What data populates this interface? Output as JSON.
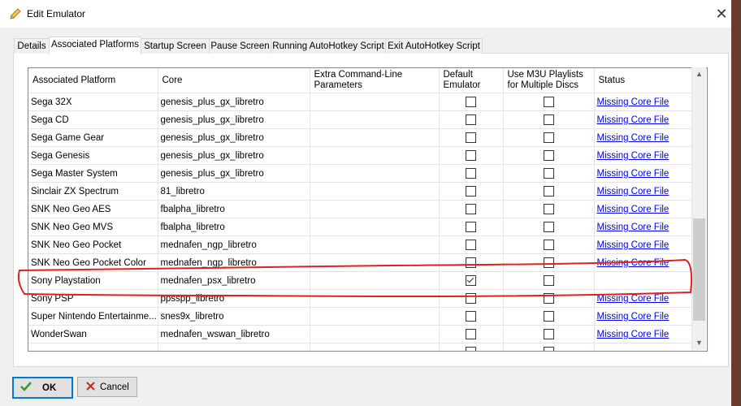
{
  "window": {
    "title": "Edit Emulator",
    "close_glyph": "✕"
  },
  "tabs": [
    {
      "label": "Details",
      "active": false
    },
    {
      "label": "Associated Platforms",
      "active": true
    },
    {
      "label": "Startup Screen",
      "active": false
    },
    {
      "label": "Pause Screen",
      "active": false
    },
    {
      "label": "Running AutoHotkey Script",
      "active": false
    },
    {
      "label": "Exit AutoHotkey Script",
      "active": false
    }
  ],
  "grid": {
    "columns": {
      "platform": "Associated Platform",
      "core": "Core",
      "extra_args": "Extra Command-Line Parameters",
      "default_emulator": "Default Emulator",
      "m3u": "Use M3U Playlists for Multiple Discs",
      "status": "Status"
    },
    "rows": [
      {
        "platform": "Sega 32X",
        "core": "genesis_plus_gx_libretro",
        "extra": "",
        "default": false,
        "m3u": false,
        "status": "Missing Core File"
      },
      {
        "platform": "Sega CD",
        "core": "genesis_plus_gx_libretro",
        "extra": "",
        "default": false,
        "m3u": false,
        "status": "Missing Core File"
      },
      {
        "platform": "Sega Game Gear",
        "core": "genesis_plus_gx_libretro",
        "extra": "",
        "default": false,
        "m3u": false,
        "status": "Missing Core File"
      },
      {
        "platform": "Sega Genesis",
        "core": "genesis_plus_gx_libretro",
        "extra": "",
        "default": false,
        "m3u": false,
        "status": "Missing Core File"
      },
      {
        "platform": "Sega Master System",
        "core": "genesis_plus_gx_libretro",
        "extra": "",
        "default": false,
        "m3u": false,
        "status": "Missing Core File"
      },
      {
        "platform": "Sinclair ZX Spectrum",
        "core": "81_libretro",
        "extra": "",
        "default": false,
        "m3u": false,
        "status": "Missing Core File"
      },
      {
        "platform": "SNK Neo Geo AES",
        "core": "fbalpha_libretro",
        "extra": "",
        "default": false,
        "m3u": false,
        "status": "Missing Core File"
      },
      {
        "platform": "SNK Neo Geo MVS",
        "core": "fbalpha_libretro",
        "extra": "",
        "default": false,
        "m3u": false,
        "status": "Missing Core File"
      },
      {
        "platform": "SNK Neo Geo Pocket",
        "core": "mednafen_ngp_libretro",
        "extra": "",
        "default": false,
        "m3u": false,
        "status": "Missing Core File"
      },
      {
        "platform": "SNK Neo Geo Pocket Color",
        "core": "mednafen_ngp_libretro",
        "extra": "",
        "default": false,
        "m3u": false,
        "status": "Missing Core File"
      },
      {
        "platform": "Sony Playstation",
        "core": "mednafen_psx_libretro",
        "extra": "",
        "default": true,
        "m3u": false,
        "status": ""
      },
      {
        "platform": "Sony PSP",
        "core": "ppsspp_libretro",
        "extra": "",
        "default": false,
        "m3u": false,
        "status": "Missing Core File"
      },
      {
        "platform": "Super Nintendo Entertainme...",
        "core": "snes9x_libretro",
        "extra": "",
        "default": false,
        "m3u": false,
        "status": "Missing Core File"
      },
      {
        "platform": "WonderSwan",
        "core": "mednafen_wswan_libretro",
        "extra": "",
        "default": false,
        "m3u": false,
        "status": "Missing Core File"
      },
      {
        "platform": "",
        "core": "",
        "extra": "",
        "default": false,
        "m3u": false,
        "status": ""
      }
    ]
  },
  "buttons": {
    "ok": "OK",
    "cancel": "Cancel"
  },
  "colors": {
    "link": "#0000ee",
    "annotation": "#e02020",
    "focus": "#0078d7",
    "ok_icon": "#2a9d2a",
    "cancel_icon": "#d42020"
  },
  "icons": {
    "title": "pencil-icon",
    "ok": "check-icon",
    "cancel": "x-icon"
  }
}
